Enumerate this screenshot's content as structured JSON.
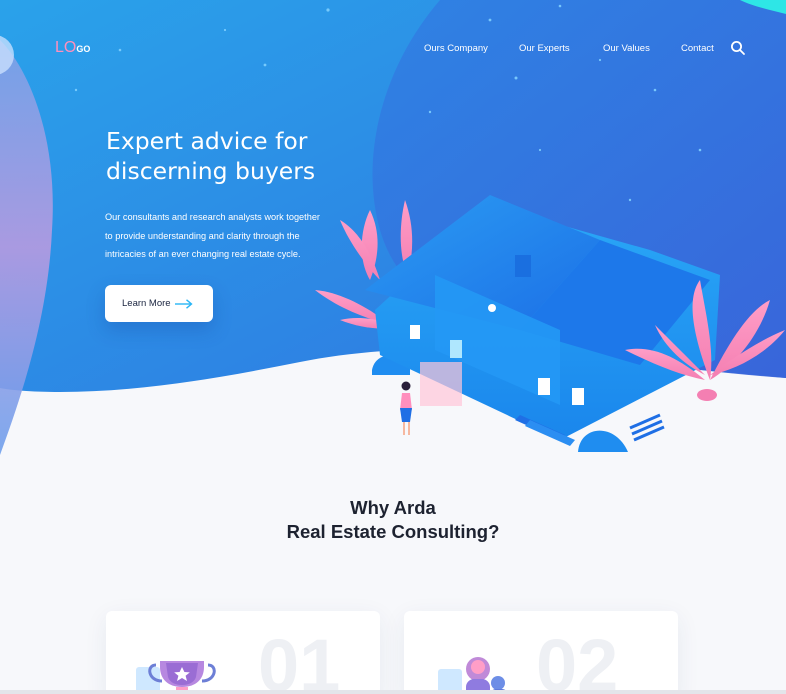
{
  "header": {
    "logo_main": "LO",
    "logo_sub": "GO",
    "nav": [
      "Ours Company",
      "Our Experts",
      "Our Values",
      "Contact"
    ]
  },
  "hero": {
    "title_lines": [
      "Expert advice for",
      "discerning buyers"
    ],
    "description_lines": [
      "Our consultants and research analysts work together",
      "to provide understanding and clarity through the",
      "intricacies of an ever changing real estate cycle."
    ],
    "cta_label": "Learn More"
  },
  "why": {
    "title_lines": [
      "Why Arda",
      "Real Estate Consulting?"
    ]
  },
  "cards": [
    {
      "number": "01",
      "icon": "trophy-icon"
    },
    {
      "number": "02",
      "icon": "people-icon"
    }
  ],
  "colors": {
    "hero_blue": "#2f8fe6",
    "hero_deep": "#3a6fe0",
    "accent_pink": "#ff8fbd",
    "cta_arrow": "#29b6f6",
    "heading_dark": "#1d2230"
  }
}
